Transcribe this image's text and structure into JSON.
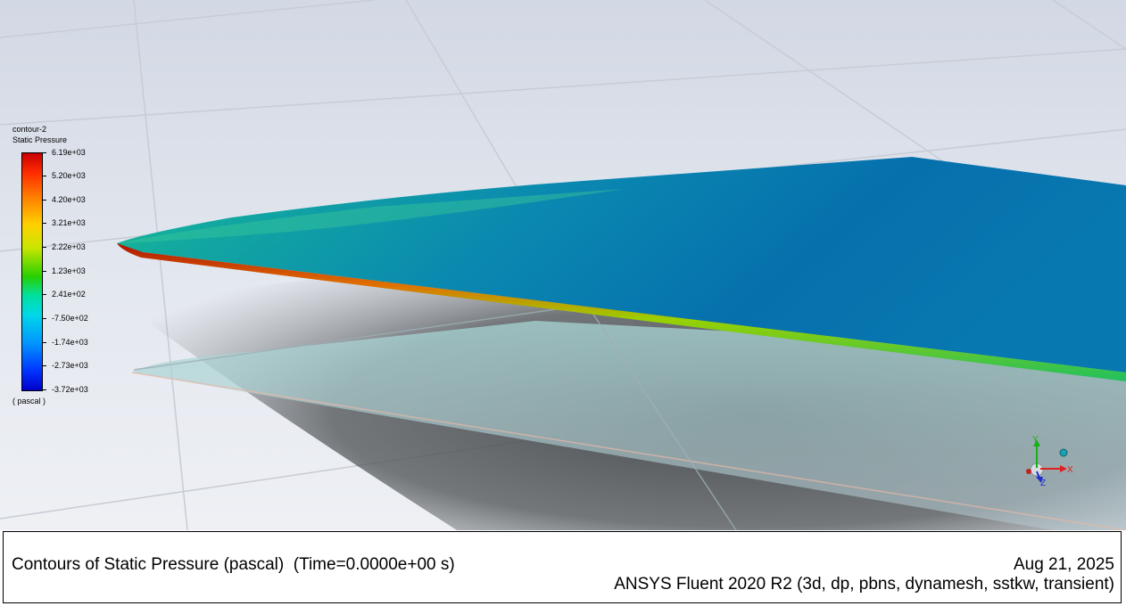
{
  "legend": {
    "title": "contour-2",
    "variable": "Static Pressure",
    "unit": "( pascal )",
    "levels": [
      "6.19e+03",
      "5.20e+03",
      "4.20e+03",
      "3.21e+03",
      "2.22e+03",
      "1.23e+03",
      "2.41e+02",
      "-7.50e+02",
      "-1.74e+03",
      "-2.73e+03",
      "-3.72e+03"
    ],
    "colors": [
      "#c80000",
      "#ff7a00",
      "#ffd000",
      "#28d000",
      "#00e0a0",
      "#0096ff",
      "#0000c8"
    ]
  },
  "info_bar": {
    "caption": "Contours of Static Pressure (pascal)  (Time=0.0000e+00 s)",
    "date": "Aug 21, 2025",
    "version": "ANSYS Fluent 2020 R2 (3d, dp, pbns, dynamesh, sstkw, transient)"
  },
  "axis_triad": {
    "x_label": "X",
    "y_label": "Y",
    "z_label": "Z"
  }
}
